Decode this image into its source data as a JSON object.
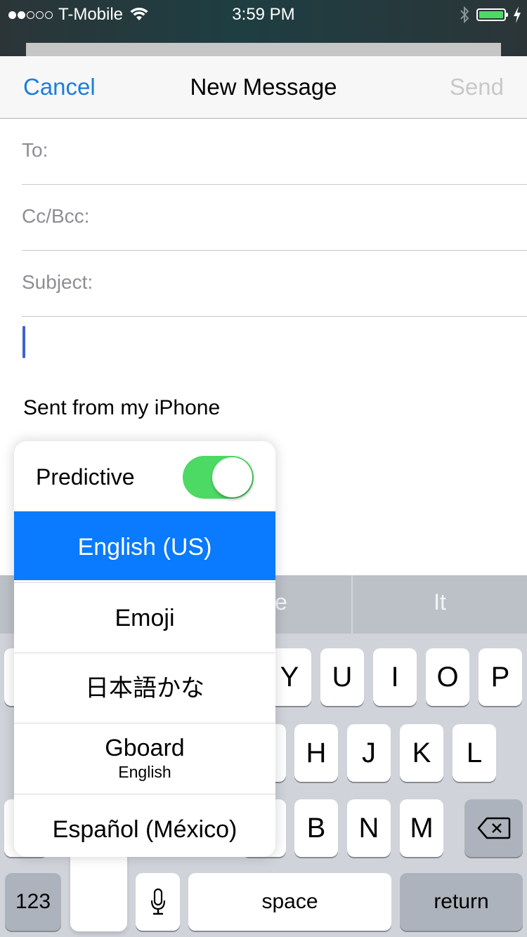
{
  "status_bar": {
    "signal_dots_filled": 2,
    "signal_dots_total": 5,
    "carrier": "T-Mobile",
    "time": "3:59 PM",
    "battery_level": 1.0,
    "charging": true,
    "bluetooth": true,
    "battery_color": "#4cd964"
  },
  "nav": {
    "cancel_label": "Cancel",
    "title": "New Message",
    "send_label": "Send",
    "accent_color": "#1d7ddb"
  },
  "compose": {
    "to_label": "To:",
    "to_value": "",
    "cc_label": "Cc/Bcc:",
    "cc_value": "",
    "subject_label": "Subject:",
    "subject_value": "",
    "body_signature": "Sent from my iPhone"
  },
  "keyboard": {
    "predictions": [
      "",
      "e",
      "It"
    ],
    "rows": [
      [
        "Y",
        "U",
        "I",
        "O",
        "P"
      ],
      [
        "H",
        "J",
        "K",
        "L"
      ],
      [
        "B",
        "N",
        "M"
      ]
    ],
    "numbers_label": "123",
    "space_label": "space",
    "return_label": "return"
  },
  "language_popup": {
    "predictive_label": "Predictive",
    "predictive_enabled": true,
    "languages": [
      {
        "label": "English (US)",
        "sub": "",
        "selected": true
      },
      {
        "label": "Emoji",
        "sub": "",
        "selected": false
      },
      {
        "label": "日本語かな",
        "sub": "",
        "selected": false
      },
      {
        "label": "Gboard",
        "sub": "English",
        "selected": false
      },
      {
        "label": "Español (México)",
        "sub": "",
        "selected": false
      }
    ],
    "selected_color": "#0a7afe"
  }
}
